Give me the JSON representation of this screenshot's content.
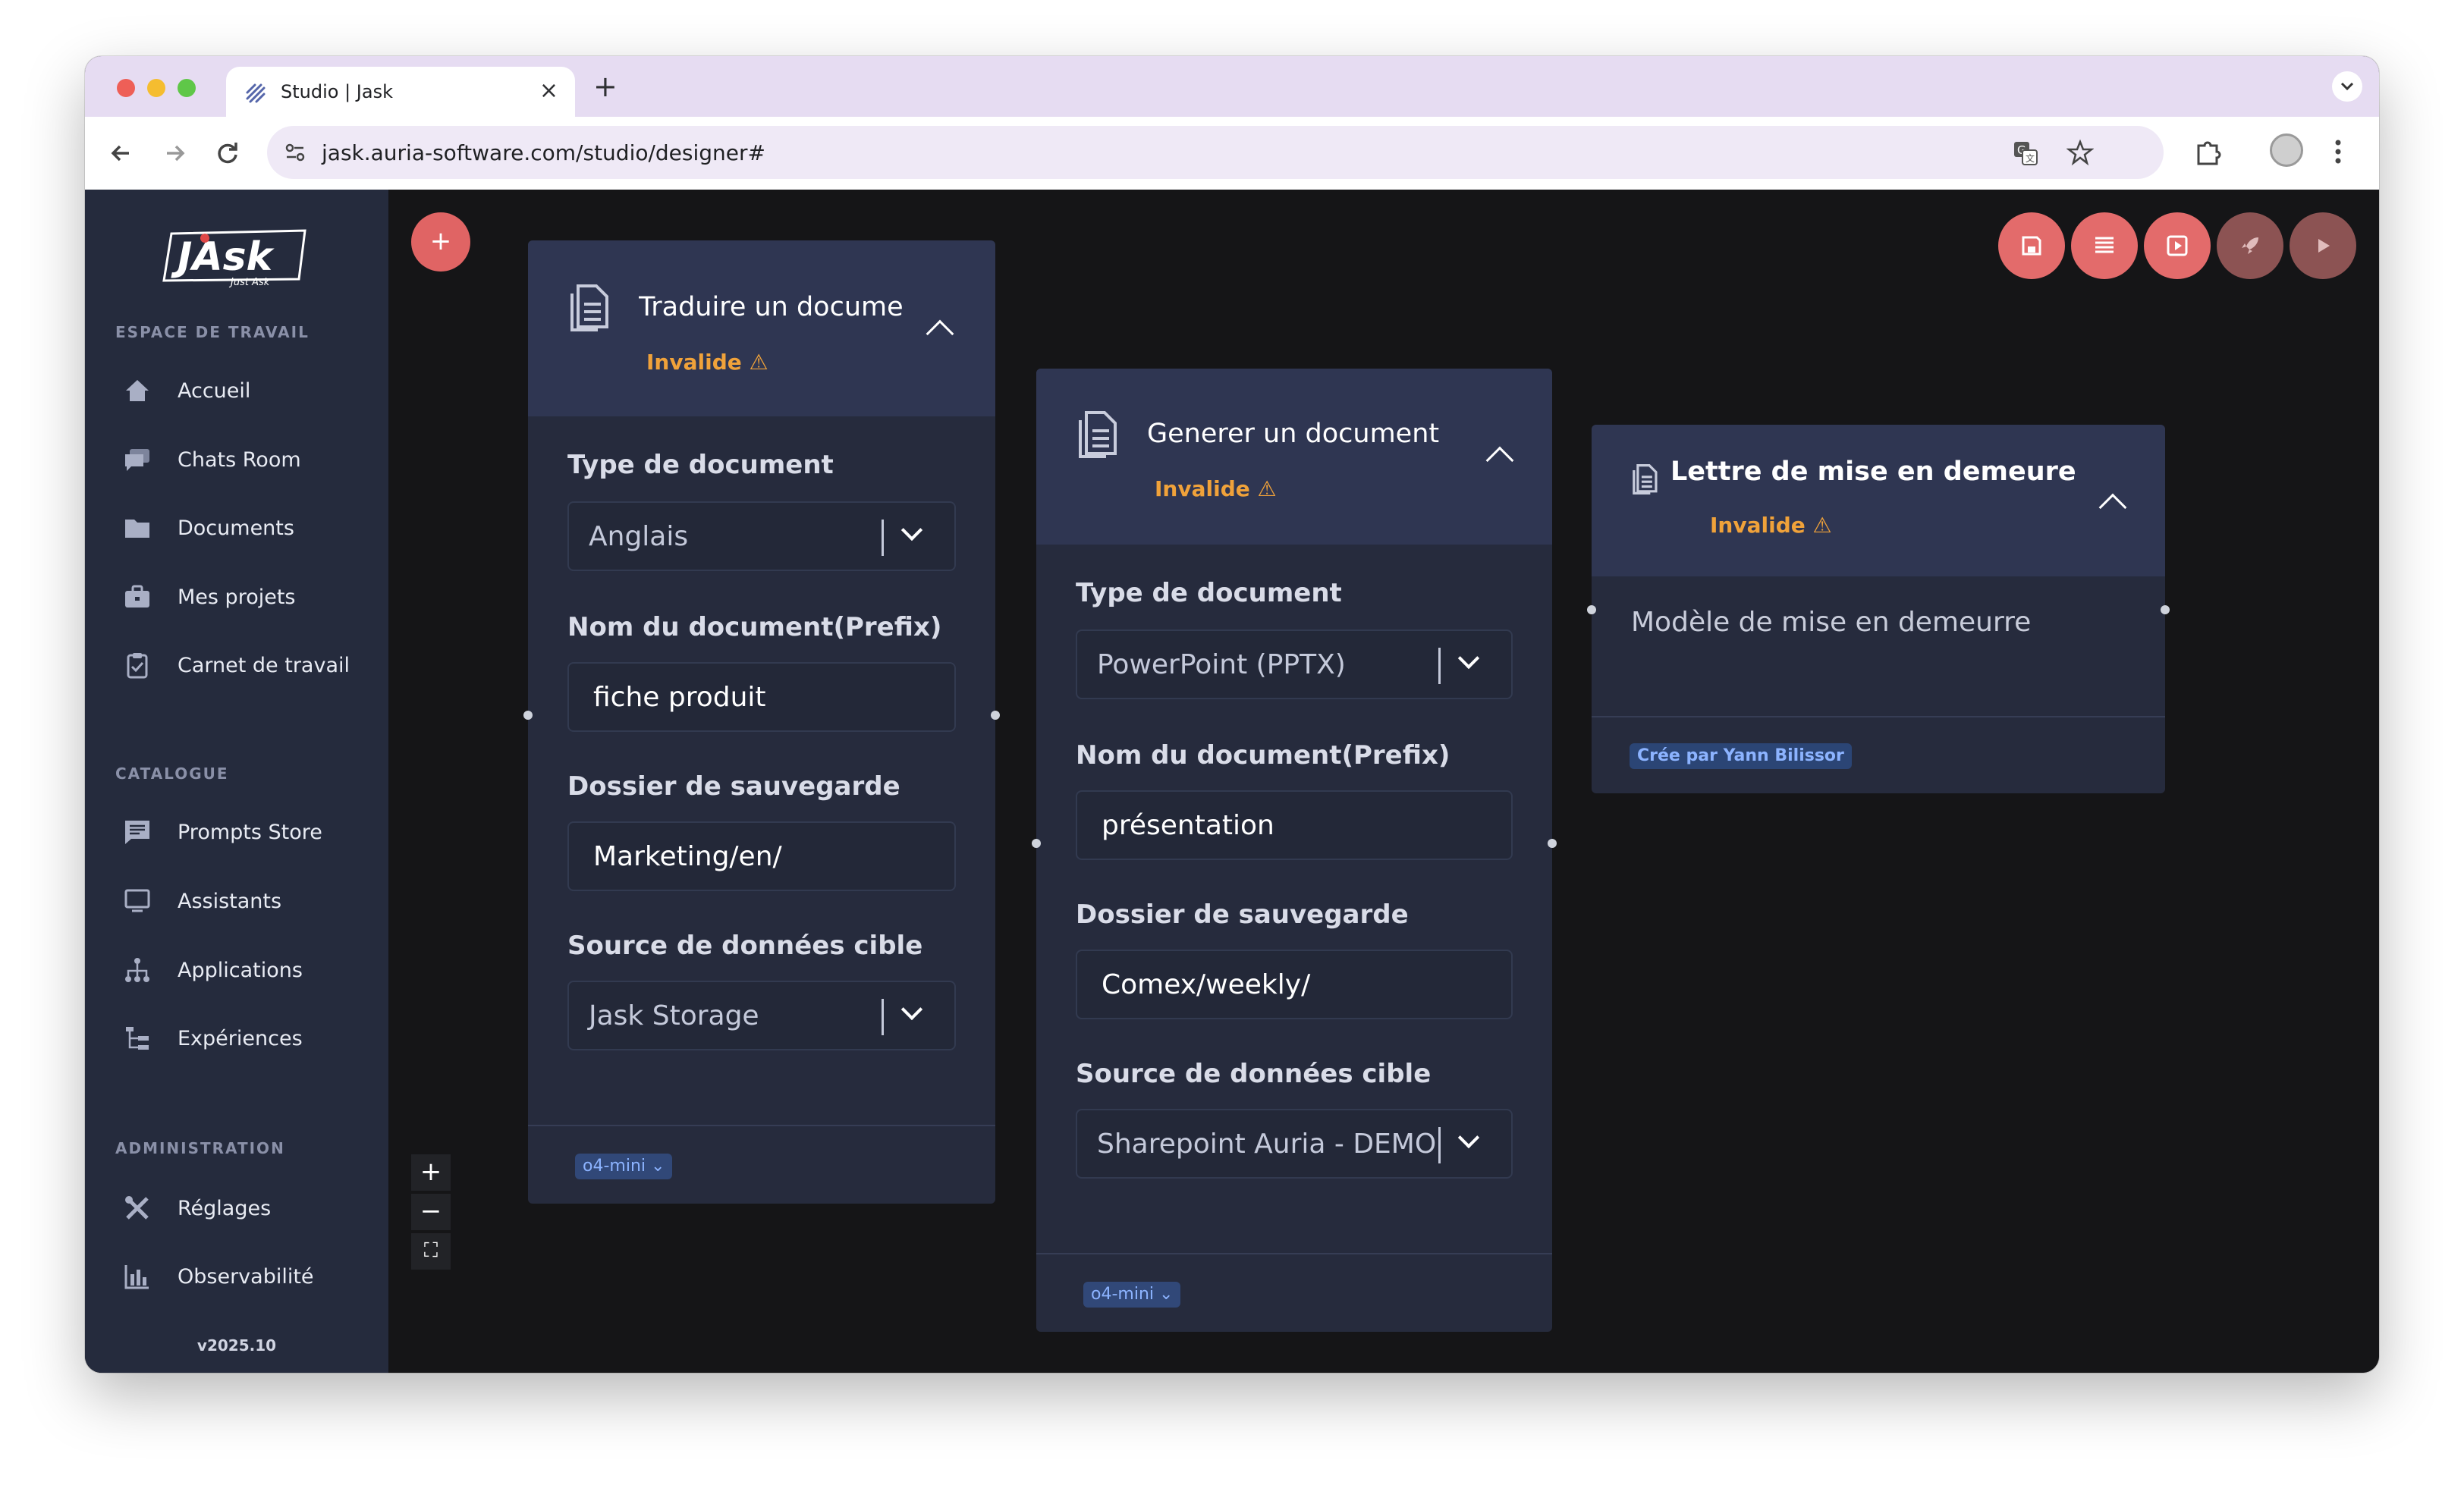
{
  "browser": {
    "tab_title": "Studio | Jask",
    "tab_close": "×",
    "new_tab": "+",
    "url": "jask.auria-software.com/studio/designer#"
  },
  "sidebar": {
    "logo_text": "JAsk",
    "logo_sub": "Just Ask",
    "section_workspace": "ESPACE DE TRAVAIL",
    "workspace_items": [
      {
        "label": "Accueil",
        "icon": "home-icon"
      },
      {
        "label": "Chats Room",
        "icon": "chat-icon"
      },
      {
        "label": "Documents",
        "icon": "folder-icon"
      },
      {
        "label": "Mes projets",
        "icon": "briefcase-icon"
      },
      {
        "label": "Carnet de travail",
        "icon": "clipboard-icon"
      }
    ],
    "section_catalogue": "CATALOGUE",
    "catalogue_items": [
      {
        "label": "Prompts Store",
        "icon": "message-icon"
      },
      {
        "label": "Assistants",
        "icon": "monitor-icon"
      },
      {
        "label": "Applications",
        "icon": "hierarchy-icon"
      },
      {
        "label": "Expériences",
        "icon": "tree-icon"
      }
    ],
    "section_admin": "ADMINISTRATION",
    "admin_items": [
      {
        "label": "Réglages",
        "icon": "tools-icon"
      },
      {
        "label": "Observabilité",
        "icon": "bar-chart-icon"
      }
    ],
    "version": "v2025.10"
  },
  "canvas": {
    "add_label": "+",
    "zoom_in": "+",
    "zoom_out": "−",
    "fit": "⛶",
    "toolbar_colors": [
      "#e36b6b",
      "#e36b6b",
      "#e36b6b",
      "#8c5353",
      "#8c5353"
    ]
  },
  "nodes": [
    {
      "title": "Traduire un docume",
      "status": "Invalide ⚠",
      "fields": [
        {
          "label": "Type de document",
          "value": "Anglais"
        },
        {
          "label": "Nom du document(Prefix)",
          "value": "fiche produit"
        },
        {
          "label": "Dossier de sauvegarde",
          "value": "Marketing/en/"
        },
        {
          "label": "Source de données cible",
          "value": "Jask Storage"
        }
      ],
      "model": "o4-mini ⌄"
    },
    {
      "title": "Generer un document",
      "status": "Invalide ⚠",
      "fields": [
        {
          "label": "Type de document",
          "value": "PowerPoint (PPTX)"
        },
        {
          "label": "Nom du document(Prefix)",
          "value": "présentation"
        },
        {
          "label": "Dossier de sauvegarde",
          "value": "Comex/weekly/"
        },
        {
          "label": "Source de données cible",
          "value": "Sharepoint Auria - DEMO"
        }
      ],
      "model": "o4-mini ⌄"
    },
    {
      "title": "Lettre de mise en demeure",
      "status": "Invalide ⚠",
      "description": "Modèle de mise en demeurre",
      "author": "Crée par Yann Bilissor"
    }
  ]
}
